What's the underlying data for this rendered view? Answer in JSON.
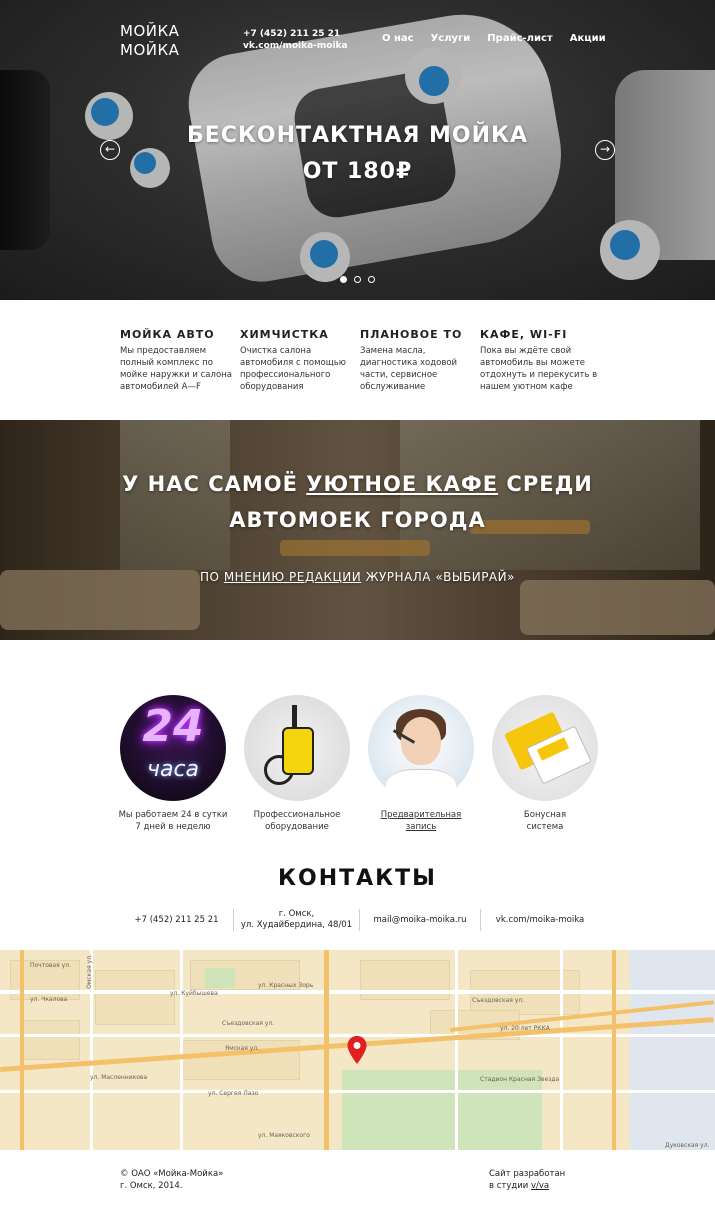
{
  "header": {
    "logo_line1": "МОЙКА",
    "logo_line2": "МОЙКА",
    "phone": "+7 (452) 211 25 21",
    "vk": "vk.com/moika-moika",
    "nav": [
      "О нас",
      "Услуги",
      "Прайс-лист",
      "Акции"
    ]
  },
  "hero": {
    "title_line1": "БЕСКОНТАКТНАЯ МОЙКА",
    "title_line2": "ОТ 180₽",
    "arrow_prev": "←",
    "arrow_next": "→",
    "slides_count": 3,
    "active_slide": 1
  },
  "services": [
    {
      "title": "МОЙКА АВТО",
      "text": "Мы предоставляем полный комплекс по мойке наружки и салона автомобилей A—F"
    },
    {
      "title": "ХИМЧИСТКА",
      "text": "Очистка салона автомобиля с помощью профессионального оборудования"
    },
    {
      "title": "ПЛАНОВОЕ ТО",
      "text": "Замена масла, диагностика ходовой части, сервисное обслуживание"
    },
    {
      "title": "КАФЕ, WI-FI",
      "text": "Пока вы ждёте свой автомобиль вы можете отдохнуть и перекусить в нашем уютном кафе"
    }
  ],
  "cafe": {
    "title_pre": "У НАС САМОЁ ",
    "title_link": "УЮТНОЕ КАФЕ",
    "title_post": " СРЕДИ",
    "title_line2": "АВТОМОЕК ГОРОДА",
    "sub_pre": "ПО ",
    "sub_link": "МНЕНИЮ РЕДАКЦИИ",
    "sub_post": " ЖУРНАЛА «ВЫБИРАЙ»"
  },
  "features": [
    {
      "icon": "neon-24-hours-icon",
      "line1": "Мы работаем 24 в сутки",
      "line2": "7 дней в неделю",
      "img_big": "24",
      "img_small": "часа"
    },
    {
      "icon": "pressure-washer-icon",
      "line1": "Профессиональное",
      "line2": "оборудование"
    },
    {
      "icon": "operator-headset-icon",
      "line1": "Предварительная",
      "line2": "запись"
    },
    {
      "icon": "bonus-card-icon",
      "line1": "Бонусная",
      "line2": "система"
    }
  ],
  "contacts": {
    "title": "КОНТАКТЫ",
    "phone": "+7 (452) 211 25 21",
    "address_line1": "г. Омск,",
    "address_line2": "ул. Худайбердина, 48/01",
    "email": "mail@moika-moika.ru",
    "vk": "vk.com/moika-moika"
  },
  "map": {
    "labels": [
      "Почтовая ул.",
      "Омская ул.",
      "ул. Красных Зорь",
      "ул. Чкалова",
      "ул. Маяковского",
      "ул. Масленникова",
      "ул. Сергея Лазо",
      "Съездовская ул.",
      "ул. 20 лет РККА",
      "Ямская ул.",
      "Съездовская ул.",
      "ул. Куйбышева",
      "Стадион Красная Звезда",
      "Дуковская ул."
    ],
    "accent_pin_color": "#e02020"
  },
  "footer": {
    "copyright": "© ОАО «Мойка-Мойка»",
    "city_year": "г. Омск, 2014.",
    "dev_text": "Сайт разработан",
    "dev_studio_pre": "в студии ",
    "dev_studio_link": "v/va"
  }
}
